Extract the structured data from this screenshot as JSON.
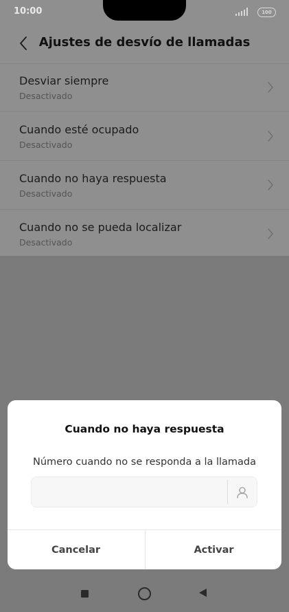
{
  "status_bar": {
    "time": "10:00",
    "battery": "100"
  },
  "header": {
    "title": "Ajustes de desvío de llamadas"
  },
  "list": {
    "items": [
      {
        "title": "Desviar siempre",
        "subtitle": "Desactivado"
      },
      {
        "title": "Cuando esté ocupado",
        "subtitle": "Desactivado"
      },
      {
        "title": "Cuando no haya respuesta",
        "subtitle": "Desactivado"
      },
      {
        "title": "Cuando no se pueda localizar",
        "subtitle": "Desactivado"
      }
    ]
  },
  "dialog": {
    "title": "Cuando no haya respuesta",
    "message": "Número cuando no se responda a la llamada",
    "input_value": "",
    "cancel_label": "Cancelar",
    "activate_label": "Activar"
  },
  "icons": {
    "back": "back-chevron-icon",
    "row_chevron": "chevron-right-icon",
    "contact": "contact-person-icon",
    "signal": "signal-icon",
    "battery": "battery-icon"
  },
  "colors": {
    "overlay_background": "#7b7b7b",
    "dialog_background": "#ffffff"
  }
}
